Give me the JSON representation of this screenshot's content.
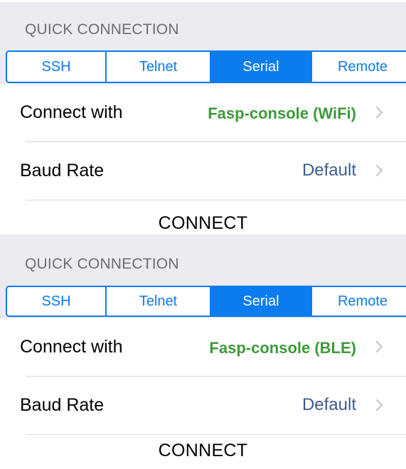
{
  "screens": [
    {
      "section_title": "QUICK CONNECTION",
      "tabs": [
        "SSH",
        "Telnet",
        "Serial",
        "Remote"
      ],
      "active_tab": "Serial",
      "connect_with_label": "Connect with",
      "connect_with_value": "Fasp-console (WiFi)",
      "baud_rate_label": "Baud Rate",
      "baud_rate_value": "Default",
      "connect_label": "CONNECT"
    },
    {
      "section_title": "QUICK CONNECTION",
      "tabs": [
        "SSH",
        "Telnet",
        "Serial",
        "Remote"
      ],
      "active_tab": "Serial",
      "connect_with_label": "Connect with",
      "connect_with_value": "Fasp-console (BLE)",
      "baud_rate_label": "Baud Rate",
      "baud_rate_value": "Default",
      "connect_label": "CONNECT"
    }
  ],
  "colors": {
    "accent": "#0a7cf0",
    "header_background": "#ebebf1",
    "section_title": "#6d6d72",
    "device_value": "#3c9a39",
    "detail_value": "#3d5c8e",
    "chevron": "#c7c7cc",
    "separator": "#d9d9de"
  },
  "icons": {
    "disclosure": "chevron-right-icon"
  }
}
